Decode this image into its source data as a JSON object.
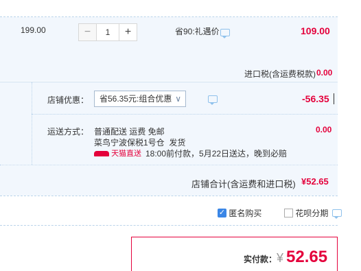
{
  "item": {
    "unit_price": "199.00",
    "quantity": "1",
    "discount_label": "省90:礼遇价",
    "subtotal": "109.00"
  },
  "tax": {
    "label": "进口税(含运费税款)",
    "value": "0.00"
  },
  "shop_discount": {
    "label": "店铺优惠：",
    "selected": "省56.35元:组合优惠",
    "value": "-56.35"
  },
  "shipping": {
    "label": "运送方式：",
    "method": "普通配送 运费 免邮",
    "warehouse": "菜鸟宁波保税1号仓",
    "ship_label": "发货",
    "value": "0.00",
    "badge": "天猫直送",
    "promise": "18:00前付款，5月22日送达，晚到必赔"
  },
  "shop_total": {
    "label": "店铺合计(含运费和进口税)",
    "value": "¥52.65"
  },
  "options": {
    "anonymous": "匿名购买",
    "installment": "花呗分期"
  },
  "payment": {
    "label": "实付款：",
    "currency": "¥",
    "amount": "52.65"
  },
  "colors": {
    "accent_red": "#e4003b",
    "checkbox_blue": "#3a86e6",
    "row_bg": "#f2f7fd"
  }
}
